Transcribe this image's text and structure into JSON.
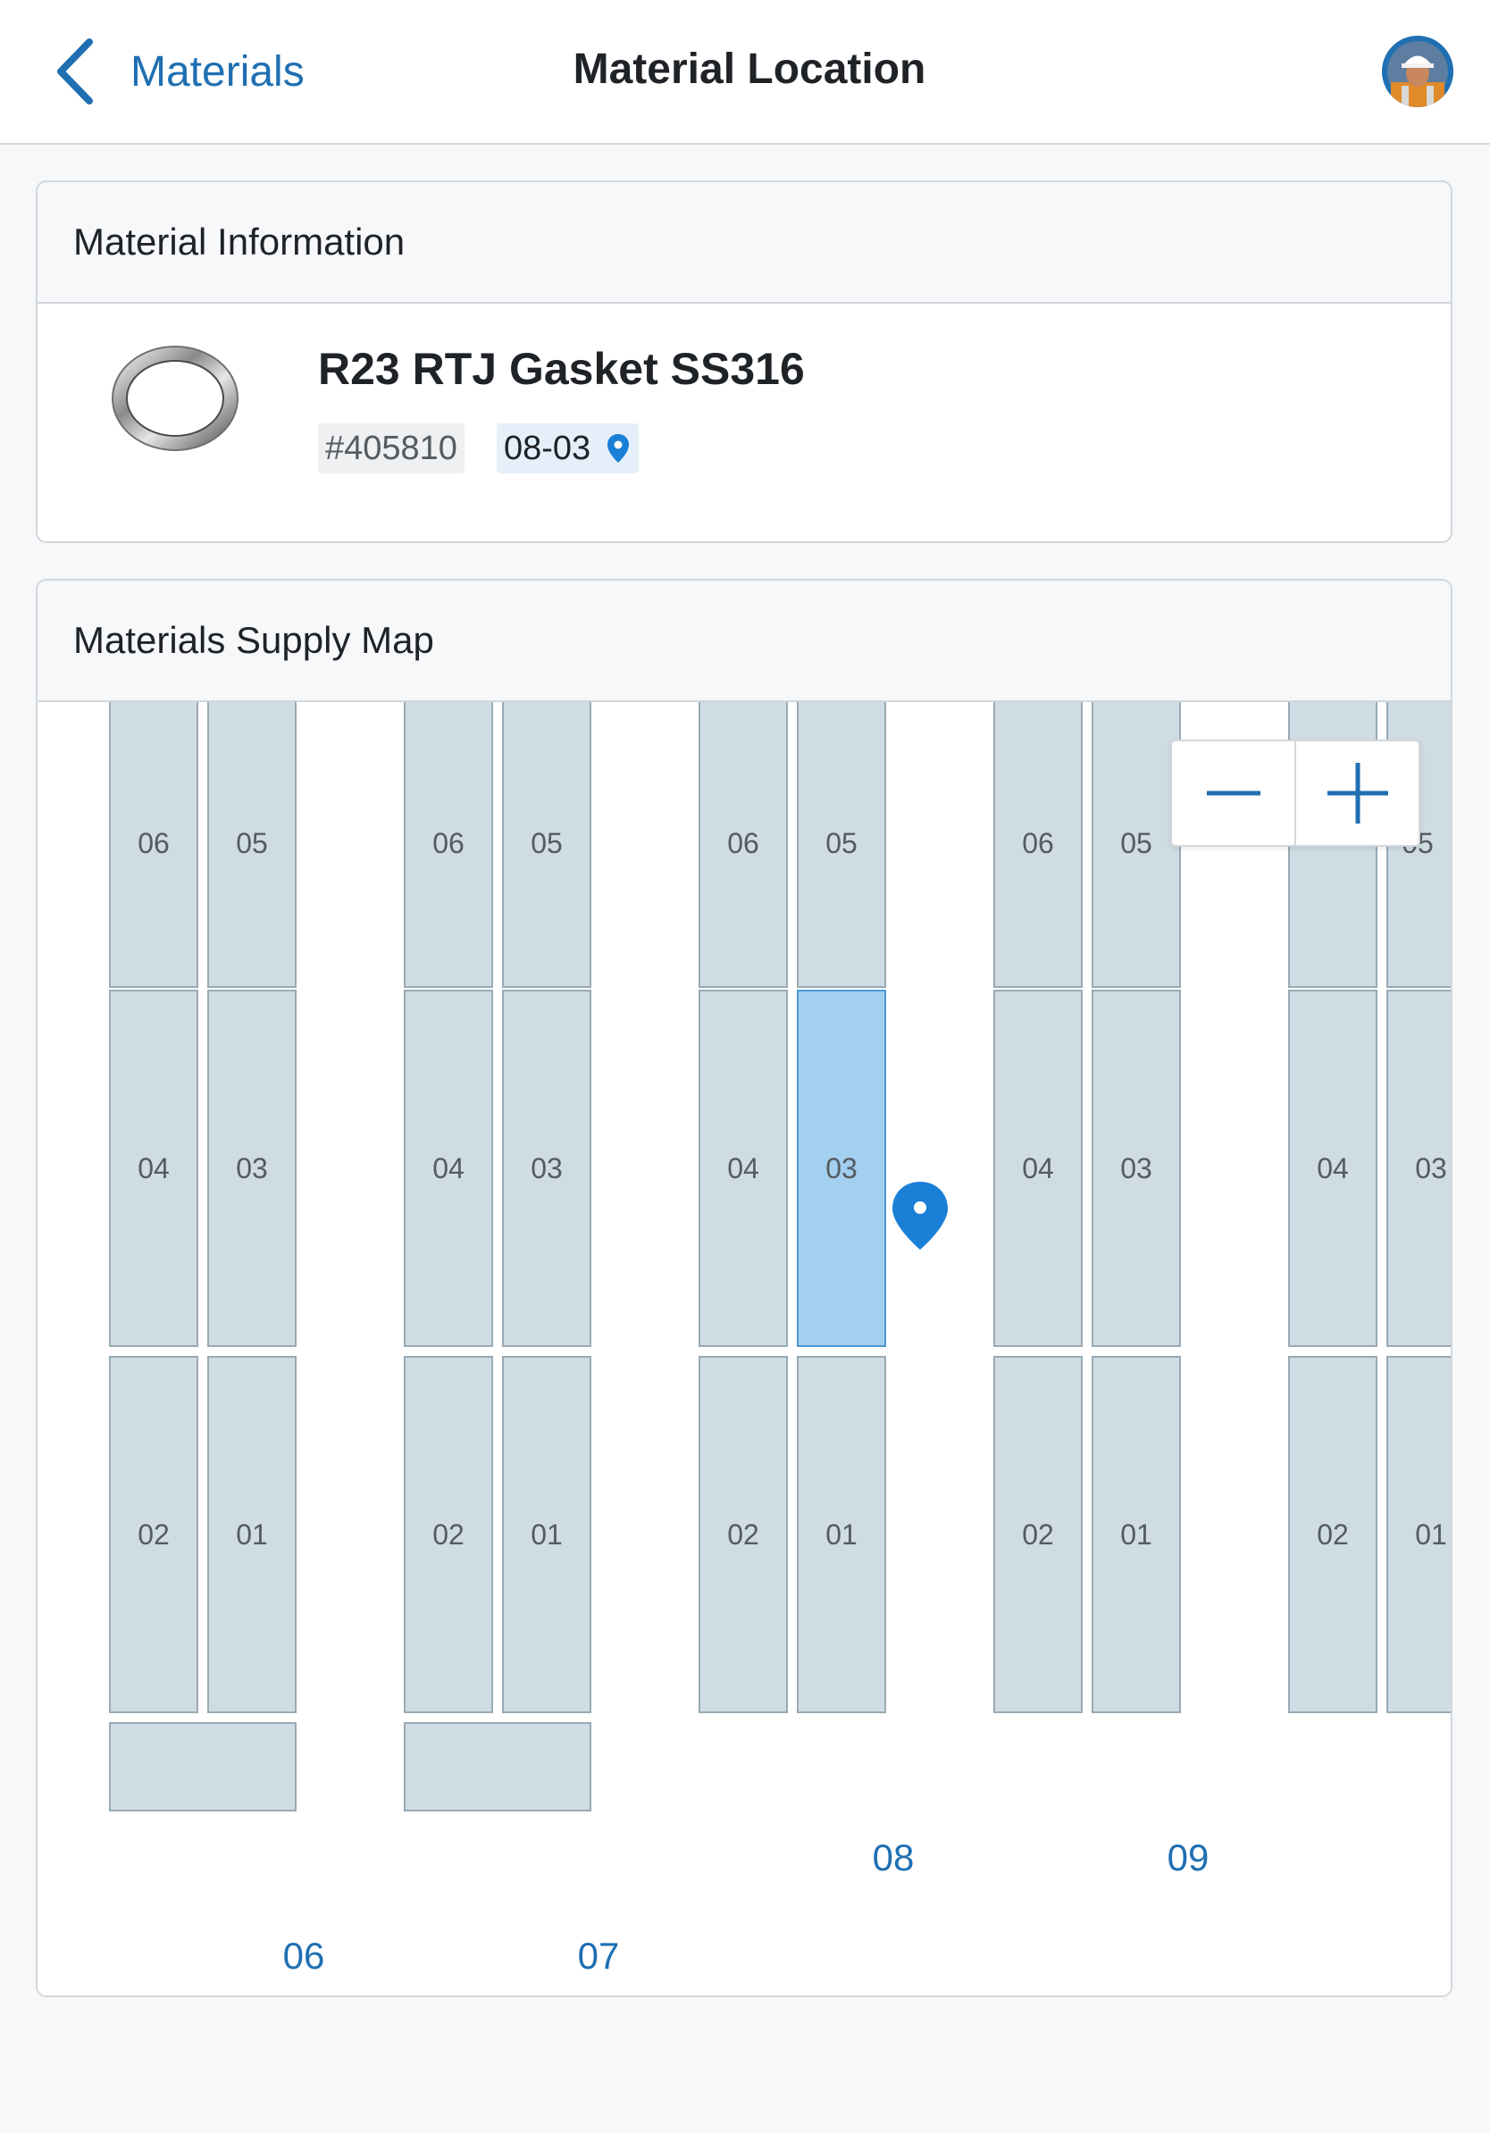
{
  "header": {
    "back_label": "Materials",
    "title": "Material Location",
    "avatar_icon": "worker-avatar"
  },
  "material_info": {
    "section_title": "Material Information",
    "name": "R23 RTJ Gasket SS316",
    "id": "#405810",
    "location": "08-03",
    "image_icon": "ring-gasket-image"
  },
  "supply_map": {
    "section_title": "Materials Supply Map",
    "zoom_out_icon": "minus-icon",
    "zoom_in_icon": "plus-icon",
    "selected_aisle": "08",
    "selected_bin": "03",
    "aisles": [
      {
        "label": "06",
        "bins": [
          "06",
          "05",
          "04",
          "03",
          "02",
          "01"
        ],
        "has_bottom_bin": true
      },
      {
        "label": "07",
        "bins": [
          "06",
          "05",
          "04",
          "03",
          "02",
          "01"
        ],
        "has_bottom_bin": true
      },
      {
        "label": "08",
        "bins": [
          "06",
          "05",
          "04",
          "03",
          "02",
          "01"
        ],
        "has_bottom_bin": false
      },
      {
        "label": "09",
        "bins": [
          "06",
          "05",
          "04",
          "03",
          "02",
          "01"
        ],
        "has_bottom_bin": false
      },
      {
        "label": "",
        "bins": [
          "",
          "05",
          "04",
          "03",
          "02",
          "01"
        ],
        "has_bottom_bin": false
      }
    ]
  },
  "colors": {
    "accent": "#1f6fb2",
    "bin_fill": "#d0dce3",
    "bin_selected": "#a4cfef",
    "pin": "#1a7fd6"
  }
}
